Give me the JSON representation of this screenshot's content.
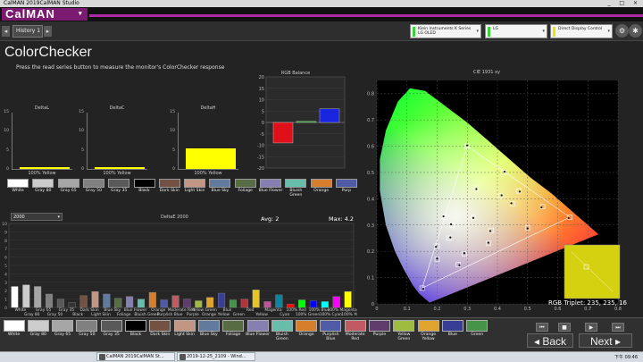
{
  "window": {
    "title": "CalMAN 2019CalMAN Studio",
    "controls": "_ □ ×"
  },
  "brand": {
    "logo": "CalMAN",
    "caret": "▾"
  },
  "tabs": {
    "prev": "◂",
    "next": "▸",
    "active": "History 1"
  },
  "devices": [
    {
      "line1": "Klein Instruments K Series",
      "line2": "LG OLED",
      "status_color": "#3ad43a"
    },
    {
      "line1": "LG",
      "line2": "",
      "status_color": "#3ad43a"
    },
    {
      "line1": "Direct Display Control",
      "line2": "",
      "status_color": "#e6e600"
    }
  ],
  "toolbar_icons": [
    "gear-icon",
    "settings-icon",
    "menu-icon"
  ],
  "page": {
    "heading": "ColorChecker",
    "instruction": "Press the read series button to measure the monitor's ColorChecker response"
  },
  "delta_charts": [
    {
      "title": "DeltaL",
      "yticks": [
        "15",
        "10",
        "5",
        "0"
      ],
      "bar_label": "100% Yellow",
      "value": 0.5
    },
    {
      "title": "DeltaC",
      "yticks": [
        "15",
        "10",
        "5",
        "0"
      ],
      "bar_label": "100% Yellow",
      "value": 0.0
    },
    {
      "title": "DeltaH",
      "yticks": [
        "15",
        "10",
        "5",
        "0"
      ],
      "bar_label": "100% Yellow",
      "value": 5.5
    }
  ],
  "rgb_balance": {
    "title": "RGB Balance",
    "yticks": [
      "20",
      "15",
      "10",
      "5",
      "0",
      "-5",
      "-10",
      "-15",
      "-20"
    ],
    "ylim": [
      -20,
      20
    ],
    "bars": [
      {
        "name": "Red",
        "value": -9,
        "color": "#e0101a"
      },
      {
        "name": "Green",
        "value": 0.5,
        "color": "#1aa61a"
      },
      {
        "name": "Blue",
        "value": 6,
        "color": "#1a25e0"
      }
    ]
  },
  "swatches": [
    {
      "label": "White",
      "color": "#ffffff"
    },
    {
      "label": "Gray 80",
      "color": "#cccccc"
    },
    {
      "label": "Gray 65",
      "color": "#a6a6a6"
    },
    {
      "label": "Gray 50",
      "color": "#808080"
    },
    {
      "label": "Gray 35",
      "color": "#595959"
    },
    {
      "label": "Black",
      "color": "#000000"
    },
    {
      "label": "Dark Skin",
      "color": "#735244"
    },
    {
      "label": "Light Skin",
      "color": "#c29682"
    },
    {
      "label": "Blue Sky",
      "color": "#627a9d"
    },
    {
      "label": "Foliage",
      "color": "#576c43"
    },
    {
      "label": "Blue Flower",
      "color": "#8580b1"
    },
    {
      "label": "Bluish Green",
      "color": "#67bdaa"
    },
    {
      "label": "Orange",
      "color": "#d67e2c"
    },
    {
      "label": "Purp",
      "color": "#505ba6"
    }
  ],
  "deltae": {
    "select": "2000",
    "select_caret": "▾",
    "title": "DeltaE 2000",
    "avg": "Avg: 2",
    "max": "Max: 4.2",
    "yticks": [
      "10",
      "9",
      "8",
      "7",
      "6",
      "5",
      "4",
      "3",
      "2",
      "1",
      "0"
    ],
    "bars": [
      {
        "v": 2.5,
        "c": "#ffffff"
      },
      {
        "v": 2.7,
        "c": "#cccccc"
      },
      {
        "v": 2.5,
        "c": "#a6a6a6"
      },
      {
        "v": 1.6,
        "c": "#808080"
      },
      {
        "v": 1.0,
        "c": "#595959"
      },
      {
        "v": 0.6,
        "c": "#333333"
      },
      {
        "v": 1.4,
        "c": "#735244"
      },
      {
        "v": 1.9,
        "c": "#c29682"
      },
      {
        "v": 1.6,
        "c": "#627a9d"
      },
      {
        "v": 1.1,
        "c": "#576c43"
      },
      {
        "v": 1.3,
        "c": "#8580b1"
      },
      {
        "v": 1.0,
        "c": "#67bdaa"
      },
      {
        "v": 1.8,
        "c": "#d67e2c"
      },
      {
        "v": 0.9,
        "c": "#505ba6"
      },
      {
        "v": 1.4,
        "c": "#c15a63"
      },
      {
        "v": 1.0,
        "c": "#5e3c6c"
      },
      {
        "v": 0.8,
        "c": "#9dbc40"
      },
      {
        "v": 1.2,
        "c": "#e0a32e"
      },
      {
        "v": 1.7,
        "c": "#383d96"
      },
      {
        "v": 0.9,
        "c": "#469449"
      },
      {
        "v": 1.0,
        "c": "#af363c"
      },
      {
        "v": 2.1,
        "c": "#e7c71f"
      },
      {
        "v": 0.7,
        "c": "#bb5695"
      },
      {
        "v": 1.5,
        "c": "#0885a1"
      },
      {
        "v": 0.4,
        "c": "#ff0000"
      },
      {
        "v": 0.9,
        "c": "#00ff00"
      },
      {
        "v": 0.8,
        "c": "#0000ff"
      },
      {
        "v": 0.7,
        "c": "#00ffff"
      },
      {
        "v": 1.3,
        "c": "#ff00ff"
      },
      {
        "v": 1.9,
        "c": "#ffff00"
      }
    ],
    "xlabels_top": [
      "White",
      "Gray 65",
      "Gray 35",
      "Dark Skin",
      "Blue Sky",
      "Blue Flower",
      "Orange",
      "Moderate Red",
      "Yellow Green",
      "Blue",
      "Red",
      "Magenta",
      "100% Red",
      "100% Blue",
      "100% Magenta"
    ],
    "xlabels_bottom": [
      "Gray 80",
      "Gray 50",
      "Black",
      "Light Skin",
      "Foliage",
      "Bluish Green",
      "Purplish Blue",
      "Purple",
      "Orange Yellow",
      "Green",
      "Yellow",
      "Cyan",
      "100% Green",
      "100% Cyan",
      "100% Yellow"
    ]
  },
  "cie": {
    "title": "CIE 1931 xy",
    "xticks": [
      "0",
      "0.1",
      "0.2",
      "0.3",
      "0.4",
      "0.5",
      "0.6",
      "0.7",
      "0.8"
    ],
    "yticks": [
      "0.8",
      "0.7",
      "0.6",
      "0.5",
      "0.4",
      "0.3",
      "0.2",
      "0.1",
      "0"
    ],
    "rgb_triplet": "RGB Triplet: 235, 235, 16"
  },
  "bottom_swatches": [
    {
      "label": "White",
      "color": "#ffffff"
    },
    {
      "label": "Gray 80",
      "color": "#cccccc"
    },
    {
      "label": "Gray 65",
      "color": "#a6a6a6"
    },
    {
      "label": "Gray 50",
      "color": "#808080"
    },
    {
      "label": "Gray 35",
      "color": "#595959"
    },
    {
      "label": "Black",
      "color": "#000000"
    },
    {
      "label": "Dark Skin",
      "color": "#735244"
    },
    {
      "label": "Light Skin",
      "color": "#c29682"
    },
    {
      "label": "Blue Sky",
      "color": "#627a9d"
    },
    {
      "label": "Foliage",
      "color": "#576c43"
    },
    {
      "label": "Blue Flower",
      "color": "#8580b1"
    },
    {
      "label": "Bluish Green",
      "color": "#67bdaa"
    },
    {
      "label": "Orange",
      "color": "#d67e2c"
    },
    {
      "label": "Purplish Blue",
      "color": "#505ba6"
    },
    {
      "label": "Moderate Red",
      "color": "#c15a63"
    },
    {
      "label": "Purple",
      "color": "#5e3c6c"
    },
    {
      "label": "Yellow Green",
      "color": "#9dbc40"
    },
    {
      "label": "Orange Yellow",
      "color": "#e0a32e"
    },
    {
      "label": "Blue",
      "color": "#383d96"
    },
    {
      "label": "Green",
      "color": "#469449"
    }
  ],
  "nav": {
    "back": "Back",
    "next": "Next",
    "back_icon": "◂",
    "next_icon": "▸"
  },
  "controls": [
    "⏮",
    "■",
    "▶",
    "⏭"
  ],
  "taskbar": {
    "items": [
      "CalMAN 2019CalMAN St...",
      "2019-12-25_2109 - Wind...",
      ""
    ],
    "clock": "下午 09:46"
  }
}
